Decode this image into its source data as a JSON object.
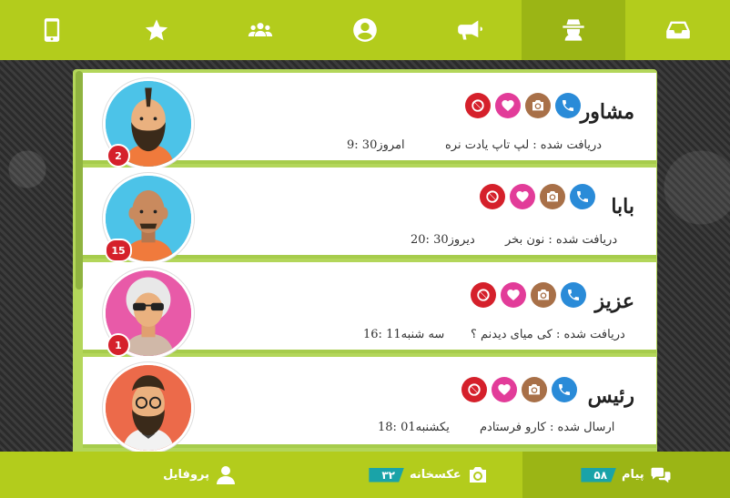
{
  "top_tabs": [
    {
      "icon": "mobile-icon",
      "active": false
    },
    {
      "icon": "star-icon",
      "active": false
    },
    {
      "icon": "users-icon",
      "active": false
    },
    {
      "icon": "user-circle-icon",
      "active": false
    },
    {
      "icon": "megaphone-icon",
      "active": false
    },
    {
      "icon": "spy-icon",
      "active": true
    },
    {
      "icon": "inbox-icon",
      "active": false
    }
  ],
  "conversations": [
    {
      "name": "مشاور",
      "message": "دریافت شده : لپ تاپ یادت نره",
      "time": "امروز30 :9",
      "badge": "2",
      "avatar_bg": "#4cc3e8"
    },
    {
      "name": "بابا",
      "message": "دریافت شده : نون بخر",
      "time": "دیروز30 :20",
      "badge": "15",
      "avatar_bg": "#4cc3e8"
    },
    {
      "name": "عزیز",
      "message": "دریافت شده : کی میای دیدنم ؟",
      "time": "سه شنبه11 :16",
      "badge": "1",
      "avatar_bg": "#e85aa8"
    },
    {
      "name": "رئیس",
      "message": "ارسال شده : کارو فرستادم",
      "time": "یکشنبه01 :18",
      "badge": "",
      "avatar_bg": "#ec6a4a"
    }
  ],
  "bottom": {
    "messages_label": "پیام",
    "messages_count": "۵۸",
    "gallery_label": "عکسخانه",
    "gallery_count": "۳۲",
    "profile_label": "پروفایل"
  },
  "colors": {
    "brand": "#b3cc1c",
    "call": "#2a8bd8",
    "photo": "#a87048",
    "like": "#e23c99",
    "block": "#d5202b",
    "badge": "#d5202b",
    "count": "#1aa3a8"
  }
}
